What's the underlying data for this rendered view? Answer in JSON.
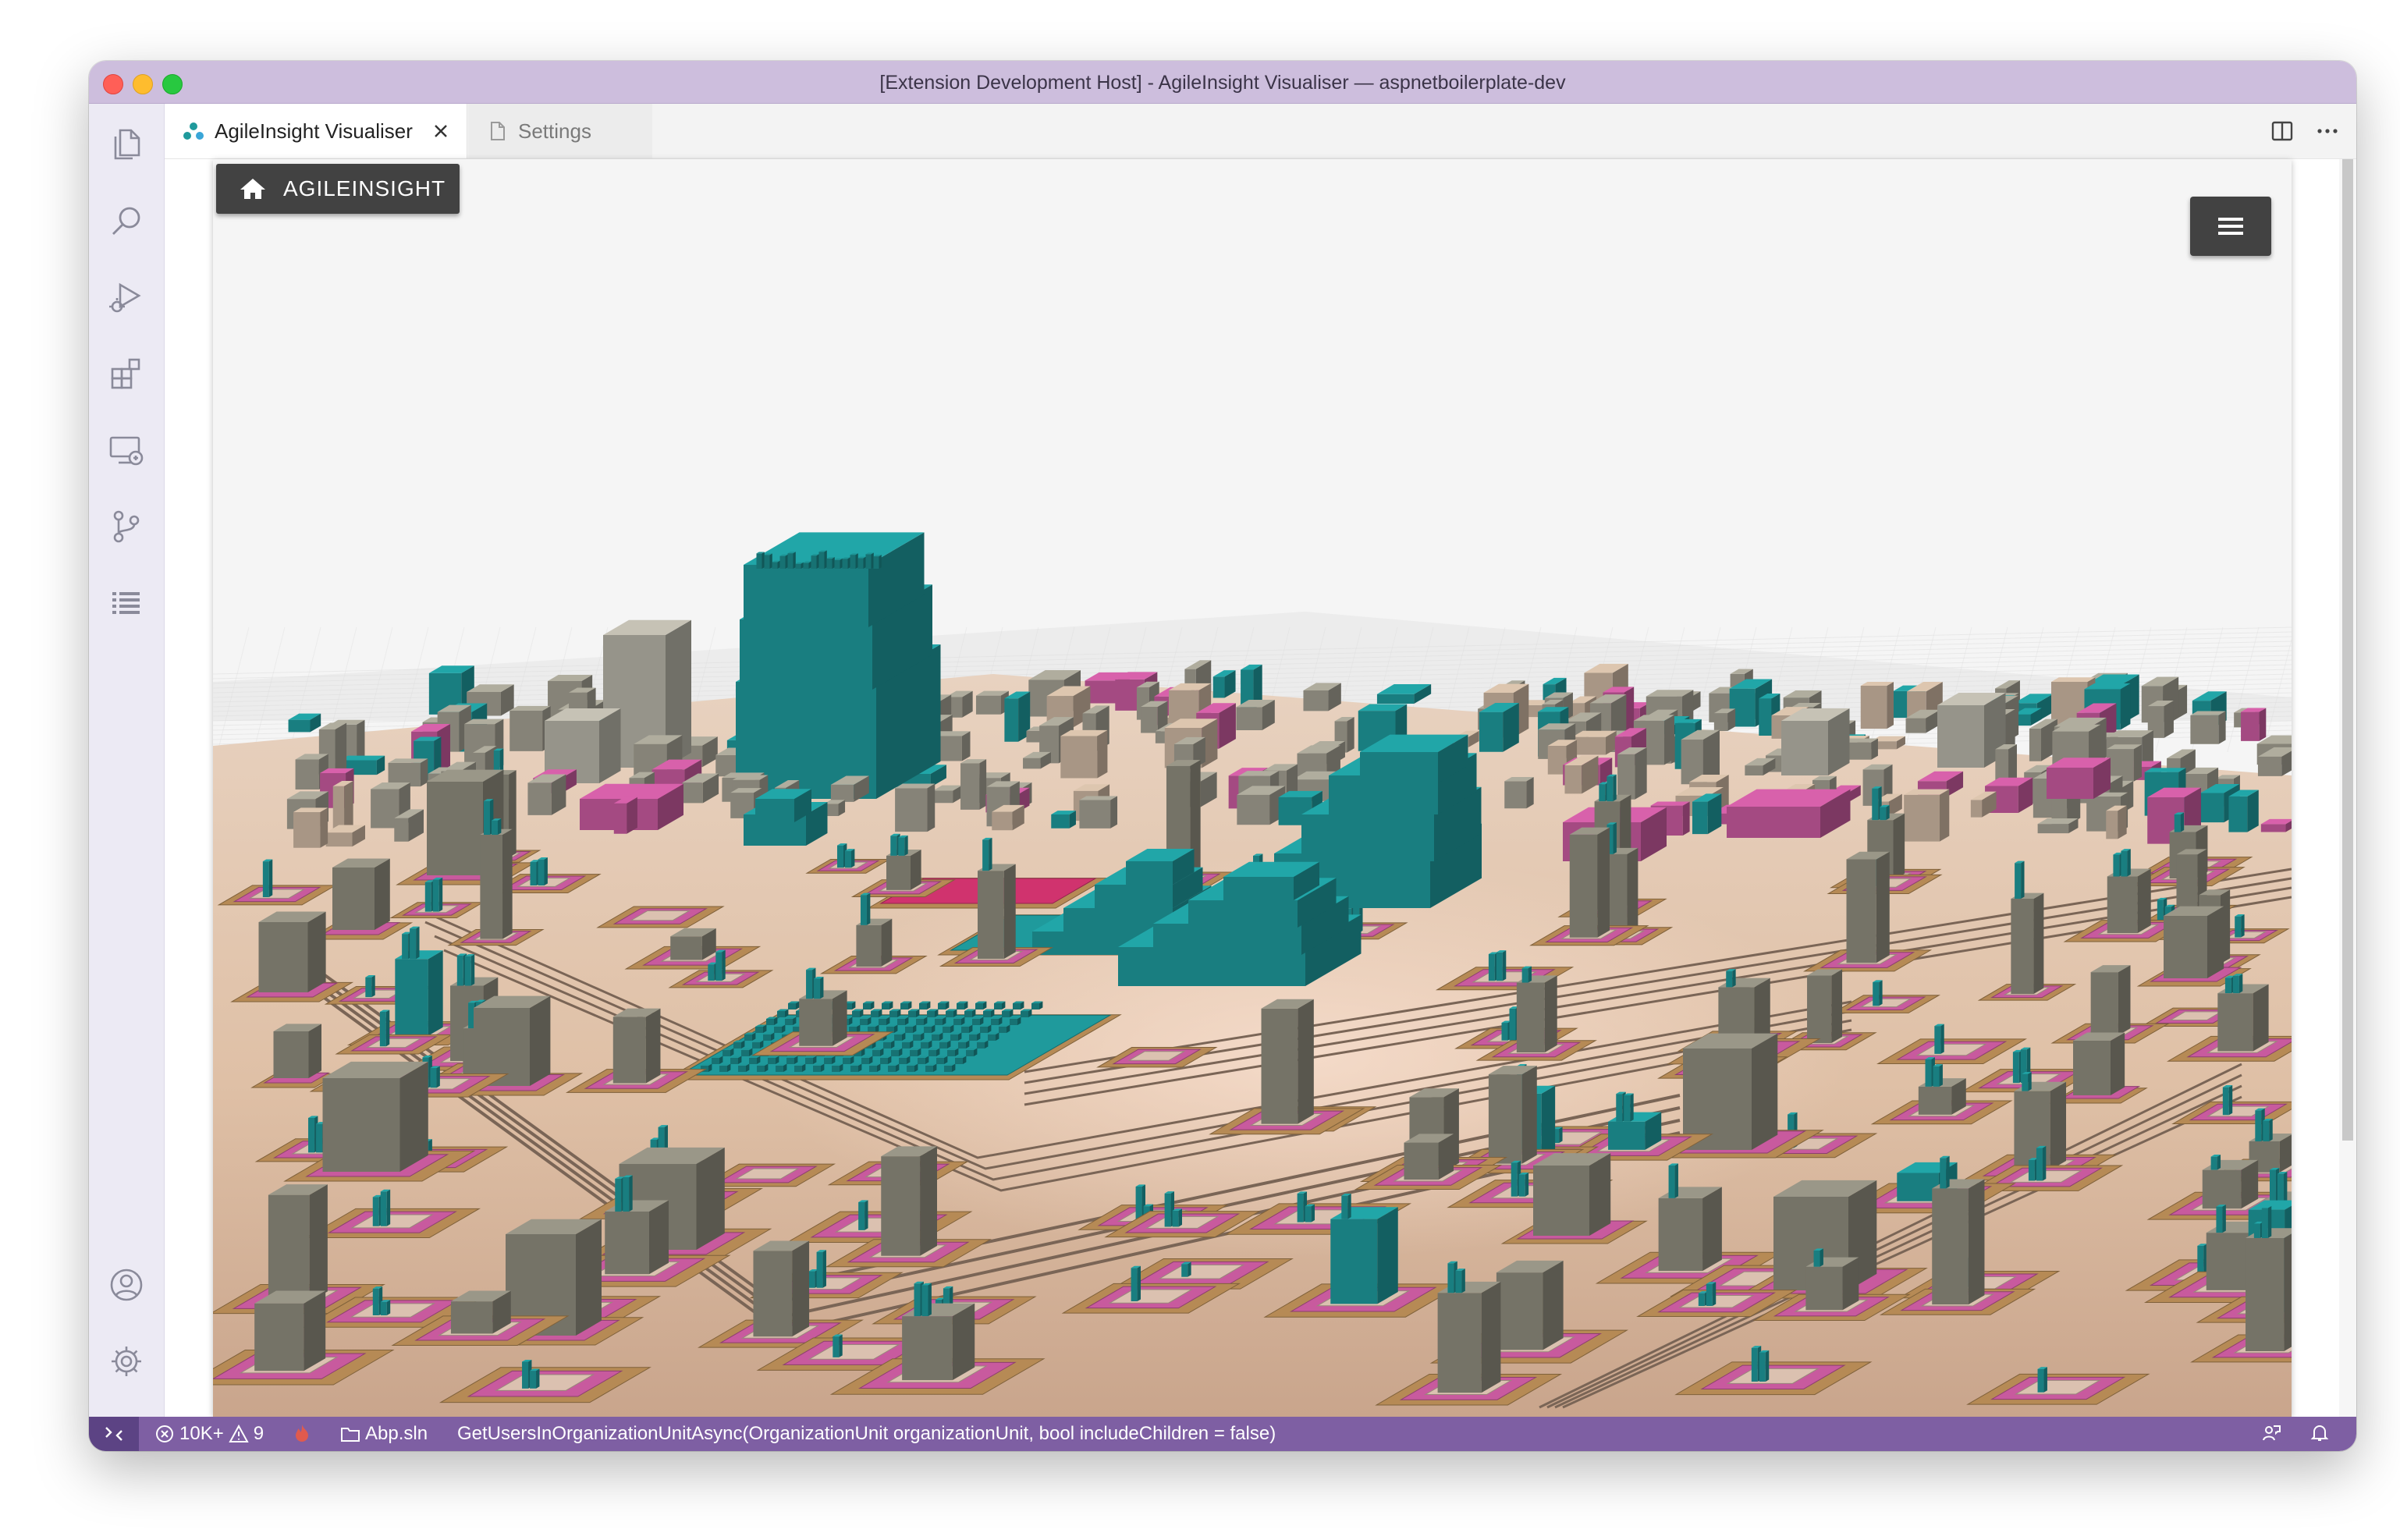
{
  "window": {
    "title": "[Extension Development Host] - AgileInsight Visualiser — aspnetboilerplate-dev"
  },
  "activity_bar": {
    "icons": [
      "files-icon",
      "search-icon",
      "run-debug-icon",
      "extensions-icon",
      "remote-explorer-icon",
      "source-control-icon",
      "list-icon",
      "account-icon",
      "gear-icon"
    ]
  },
  "tabs": [
    {
      "label": "AgileInsight Visualiser",
      "active": true
    },
    {
      "label": "Settings",
      "active": false
    }
  ],
  "visualiser": {
    "brand_label": "AGILEINSIGHT"
  },
  "statusbar": {
    "errors": "10K+",
    "warnings": "9",
    "solution": "Abp.sln",
    "context": "GetUsersInOrganizationUnitAsync(OrganizationUnit organizationUnit, bool includeChildren = false)"
  },
  "colors": {
    "titlebar": "#cdbedd",
    "statusbar": "#7e5fa3",
    "ground": "#e6c9b4",
    "teal": "#1f9a9c",
    "gray_building": "#a3a092",
    "pink": "#c85a9e",
    "magenta": "#d0336e"
  }
}
